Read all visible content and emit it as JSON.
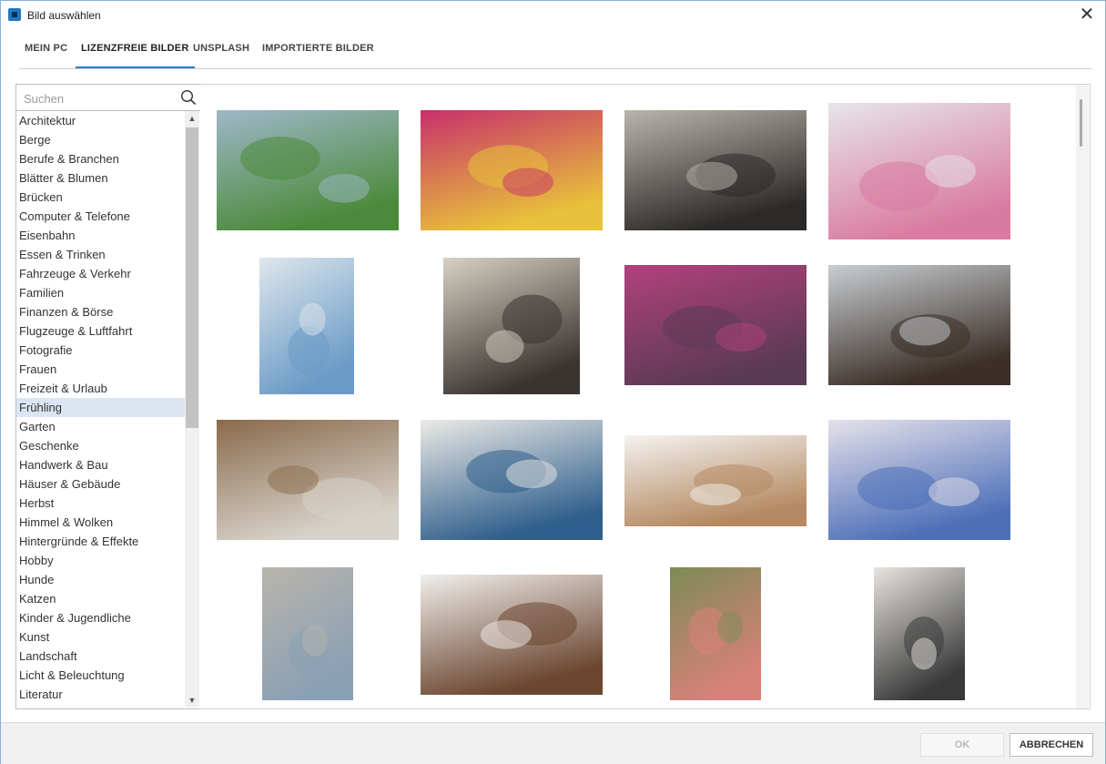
{
  "window": {
    "title": "Bild auswählen",
    "close_symbol": "✕"
  },
  "tabs": [
    {
      "label": "MEIN PC"
    },
    {
      "label": "LIZENZFREIE BILDER",
      "active": true
    },
    {
      "label": "UNSPLASH"
    },
    {
      "label": "IMPORTIERTE BILDER"
    }
  ],
  "search": {
    "placeholder": "Suchen",
    "value": ""
  },
  "categories": [
    "Architektur",
    "Berge",
    "Berufe & Branchen",
    "Blätter & Blumen",
    "Brücken",
    "Computer & Telefone",
    "Eisenbahn",
    "Essen & Trinken",
    "Fahrzeuge & Verkehr",
    "Familien",
    "Finanzen & Börse",
    "Flugzeuge & Luftfahrt",
    "Fotografie",
    "Frauen",
    "Freizeit & Urlaub",
    "Frühling",
    "Garten",
    "Geschenke",
    "Handwerk & Bau",
    "Häuser & Gebäude",
    "Herbst",
    "Himmel & Wolken",
    "Hintergründe & Effekte",
    "Hobby",
    "Hunde",
    "Katzen",
    "Kinder & Jugendliche",
    "Kunst",
    "Landschaft",
    "Licht & Beleuchtung",
    "Literatur"
  ],
  "selected_category": "Frühling",
  "images": [
    {
      "icon": "tree-meadow-photo",
      "colors": [
        "#9fb7c9",
        "#4b8a3a"
      ]
    },
    {
      "icon": "tulips-photo",
      "colors": [
        "#c8306b",
        "#e8c23a"
      ]
    },
    {
      "icon": "easter-eggs-nest-photo",
      "colors": [
        "#b9b5ad",
        "#2c2a28"
      ]
    },
    {
      "icon": "flower-bouquet-jug-photo",
      "colors": [
        "#e6e6e8",
        "#d97aa0"
      ]
    },
    {
      "icon": "teacup-hands-photo",
      "colors": [
        "#dfe6ec",
        "#6a9bc7"
      ]
    },
    {
      "icon": "woman-street-photo",
      "colors": [
        "#d8d2c4",
        "#3a3330"
      ]
    },
    {
      "icon": "pink-blossom-tree-photo",
      "colors": [
        "#b2417e",
        "#5b3a54"
      ]
    },
    {
      "icon": "garden-trowel-soil-photo",
      "colors": [
        "#c9ced2",
        "#3b2f28"
      ]
    },
    {
      "icon": "potting-table-photo",
      "colors": [
        "#8a6a4c",
        "#d7d2c9"
      ]
    },
    {
      "icon": "woman-cafe-photo",
      "colors": [
        "#eceae6",
        "#2f5f8c"
      ]
    },
    {
      "icon": "writing-desk-photo",
      "colors": [
        "#f4f3f1",
        "#b58a62"
      ]
    },
    {
      "icon": "grape-hyacinth-photo",
      "colors": [
        "#e5e1ea",
        "#4d6fb8"
      ]
    },
    {
      "icon": "woman-field-photo",
      "colors": [
        "#b9b4ab",
        "#8aa0b4"
      ]
    },
    {
      "icon": "coffee-table-photo",
      "colors": [
        "#f1efed",
        "#6b4630"
      ]
    },
    {
      "icon": "flower-market-photo",
      "colors": [
        "#7c8b55",
        "#d8817a"
      ]
    },
    {
      "icon": "kitchen-pouring-photo",
      "colors": [
        "#e7e4df",
        "#3a3a3a"
      ]
    }
  ],
  "footer": {
    "ok_label": "OK",
    "cancel_label": "ABBRECHEN"
  }
}
